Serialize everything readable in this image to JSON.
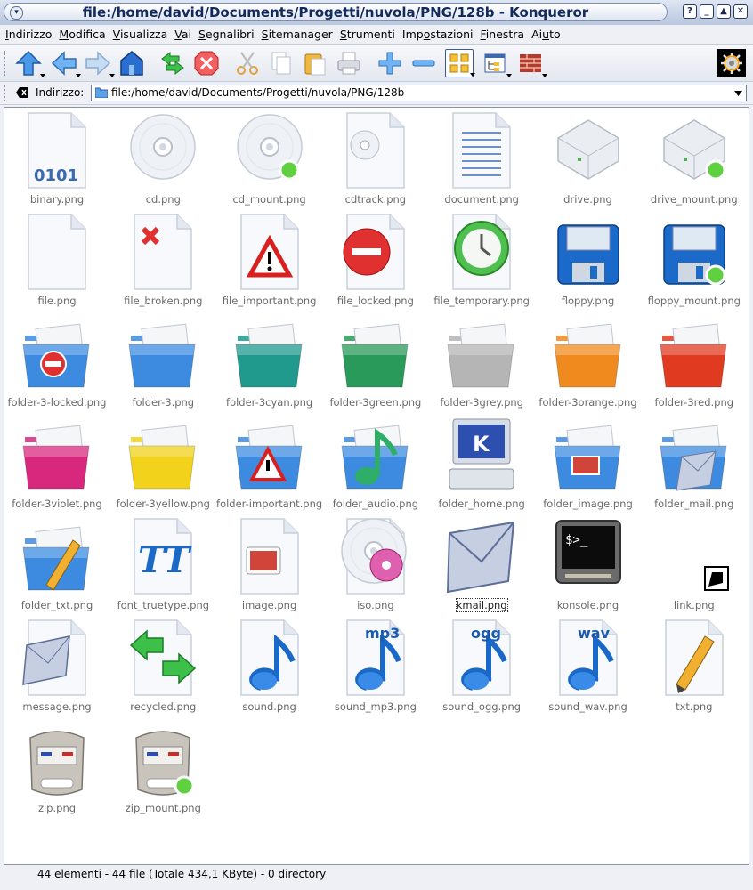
{
  "window": {
    "title": "file:/home/david/Documents/Progetti/nuvola/PNG/128b - Konqueror",
    "menu_glyph": "▾",
    "buttons": [
      {
        "name": "help",
        "glyph": "?"
      },
      {
        "name": "minimize",
        "glyph": "_"
      },
      {
        "name": "maximize",
        "glyph": "▲"
      },
      {
        "name": "close",
        "glyph": "✕"
      }
    ]
  },
  "menubar": [
    {
      "pre": "",
      "key": "I",
      "post": "ndirizzo"
    },
    {
      "pre": "",
      "key": "M",
      "post": "odifica"
    },
    {
      "pre": "",
      "key": "V",
      "post": "isualizza"
    },
    {
      "pre": "",
      "key": "V",
      "post": "ai"
    },
    {
      "pre": "",
      "key": "S",
      "post": "egnalibri"
    },
    {
      "pre": "",
      "key": "S",
      "post": "itemanager"
    },
    {
      "pre": "",
      "key": "S",
      "post": "trumenti"
    },
    {
      "pre": "Imp",
      "key": "o",
      "post": "stazioni"
    },
    {
      "pre": "",
      "key": "F",
      "post": "inestra"
    },
    {
      "pre": "Ai",
      "key": "u",
      "post": "to"
    }
  ],
  "toolbar": {
    "icons": [
      "up-arrow-icon",
      "back-arrow-icon",
      "forward-arrow-icon",
      "home-icon",
      "reload-icon",
      "stop-icon",
      "cut-icon",
      "copy-icon",
      "paste-icon",
      "print-icon",
      "zoom-in-icon",
      "zoom-out-icon",
      "icon-view-icon",
      "tree-view-icon",
      "security-firewall-icon",
      "konqueror-gear-icon"
    ]
  },
  "location": {
    "label": "Indirizzo:",
    "value": "file:/home/david/Documents/Progetti/nuvola/PNG/128b"
  },
  "files": [
    {
      "name": "binary.png",
      "icon": "binary"
    },
    {
      "name": "cd.png",
      "icon": "cd"
    },
    {
      "name": "cd_mount.png",
      "icon": "cd_mount"
    },
    {
      "name": "cdtrack.png",
      "icon": "cdtrack"
    },
    {
      "name": "document.png",
      "icon": "document"
    },
    {
      "name": "drive.png",
      "icon": "drive"
    },
    {
      "name": "drive_mount.png",
      "icon": "drive_mount"
    },
    {
      "name": "file.png",
      "icon": "file"
    },
    {
      "name": "file_broken.png",
      "icon": "file_broken"
    },
    {
      "name": "file_important.png",
      "icon": "file_important"
    },
    {
      "name": "file_locked.png",
      "icon": "file_locked"
    },
    {
      "name": "file_temporary.png",
      "icon": "file_temporary"
    },
    {
      "name": "floppy.png",
      "icon": "floppy"
    },
    {
      "name": "floppy_mount.png",
      "icon": "floppy_mount"
    },
    {
      "name": "folder-3-locked.png",
      "icon": "folder_locked"
    },
    {
      "name": "folder-3.png",
      "icon": "folder_blue"
    },
    {
      "name": "folder-3cyan.png",
      "icon": "folder_cyan"
    },
    {
      "name": "folder-3green.png",
      "icon": "folder_green"
    },
    {
      "name": "folder-3grey.png",
      "icon": "folder_grey"
    },
    {
      "name": "folder-3orange.png",
      "icon": "folder_orange"
    },
    {
      "name": "folder-3red.png",
      "icon": "folder_red"
    },
    {
      "name": "folder-3violet.png",
      "icon": "folder_violet"
    },
    {
      "name": "folder-3yellow.png",
      "icon": "folder_yellow"
    },
    {
      "name": "folder-important.png",
      "icon": "folder_important"
    },
    {
      "name": "folder_audio.png",
      "icon": "folder_audio"
    },
    {
      "name": "folder_home.png",
      "icon": "folder_home"
    },
    {
      "name": "folder_image.png",
      "icon": "folder_image"
    },
    {
      "name": "folder_mail.png",
      "icon": "folder_mail"
    },
    {
      "name": "folder_txt.png",
      "icon": "folder_txt"
    },
    {
      "name": "font_truetype.png",
      "icon": "font_truetype"
    },
    {
      "name": "image.png",
      "icon": "image"
    },
    {
      "name": "iso.png",
      "icon": "iso"
    },
    {
      "name": "kmail.png",
      "icon": "kmail"
    },
    {
      "name": "konsole.png",
      "icon": "konsole"
    },
    {
      "name": "link.png",
      "icon": "link"
    },
    {
      "name": "message.png",
      "icon": "message"
    },
    {
      "name": "recycled.png",
      "icon": "recycled"
    },
    {
      "name": "sound.png",
      "icon": "sound"
    },
    {
      "name": "sound_mp3.png",
      "icon": "sound_mp3"
    },
    {
      "name": "sound_ogg.png",
      "icon": "sound_ogg"
    },
    {
      "name": "sound_wav.png",
      "icon": "sound_wav"
    },
    {
      "name": "txt.png",
      "icon": "txt"
    },
    {
      "name": "zip.png",
      "icon": "zip"
    },
    {
      "name": "zip_mount.png",
      "icon": "zip_mount"
    }
  ],
  "icon_texts": {
    "binary": "0101",
    "konsole": "$>_",
    "font": "TT",
    "home": "K",
    "mp3": "mp3",
    "ogg": "ogg",
    "wav": "wav"
  },
  "selected_file": "kmail.png",
  "colors": {
    "folder_blue": "#3d8be0",
    "folder_cyan": "#1f9a8c",
    "folder_green": "#2a9a5a",
    "folder_grey": "#b5b5b5",
    "folder_orange": "#f08a1e",
    "folder_red": "#e03a20",
    "folder_violet": "#d8287e",
    "folder_yellow": "#f2d21a",
    "label": "#6a6a6a"
  },
  "status": "44 elementi - 44 file (Totale 434,1 KByte) - 0 directory"
}
